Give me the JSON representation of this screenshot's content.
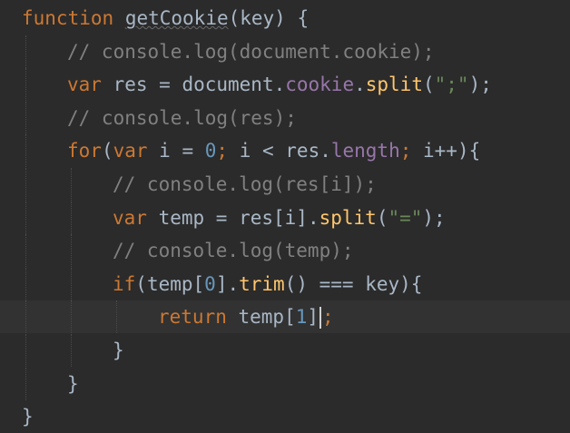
{
  "editor": {
    "lines": [
      {
        "tokens": [
          {
            "t": "kw",
            "v": "function"
          },
          {
            "t": "op",
            "v": " "
          },
          {
            "t": "fn-def",
            "v": "getCookie"
          },
          {
            "t": "op",
            "v": "(key) {"
          }
        ],
        "indent": 0
      },
      {
        "tokens": [
          {
            "t": "cm",
            "v": "// console.log(document.cookie);"
          }
        ],
        "indent": 1
      },
      {
        "tokens": [
          {
            "t": "kw",
            "v": "var"
          },
          {
            "t": "op",
            "v": " res = document."
          },
          {
            "t": "prop",
            "v": "cookie"
          },
          {
            "t": "op",
            "v": "."
          },
          {
            "t": "fn",
            "v": "split"
          },
          {
            "t": "op",
            "v": "("
          },
          {
            "t": "str",
            "v": "\";\""
          },
          {
            "t": "op",
            "v": ");"
          }
        ],
        "indent": 1
      },
      {
        "tokens": [
          {
            "t": "cm",
            "v": "// console.log(res);"
          }
        ],
        "indent": 1
      },
      {
        "tokens": [
          {
            "t": "kw",
            "v": "for"
          },
          {
            "t": "op",
            "v": "("
          },
          {
            "t": "kw",
            "v": "var"
          },
          {
            "t": "op",
            "v": " i = "
          },
          {
            "t": "num",
            "v": "0"
          },
          {
            "t": "kw",
            "v": ";"
          },
          {
            "t": "op",
            "v": " i < res."
          },
          {
            "t": "prop",
            "v": "length"
          },
          {
            "t": "kw",
            "v": ";"
          },
          {
            "t": "op",
            "v": " i++){"
          }
        ],
        "indent": 1
      },
      {
        "tokens": [
          {
            "t": "cm",
            "v": "// console.log(res[i]);"
          }
        ],
        "indent": 2
      },
      {
        "tokens": [
          {
            "t": "kw",
            "v": "var"
          },
          {
            "t": "op",
            "v": " temp = res[i]."
          },
          {
            "t": "fn",
            "v": "split"
          },
          {
            "t": "op",
            "v": "("
          },
          {
            "t": "str",
            "v": "\"=\""
          },
          {
            "t": "op",
            "v": ");"
          }
        ],
        "indent": 2
      },
      {
        "tokens": [
          {
            "t": "cm",
            "v": "// console.log(temp);"
          }
        ],
        "indent": 2
      },
      {
        "tokens": [
          {
            "t": "kw",
            "v": "if"
          },
          {
            "t": "op",
            "v": "(temp["
          },
          {
            "t": "num",
            "v": "0"
          },
          {
            "t": "op",
            "v": "]."
          },
          {
            "t": "fn",
            "v": "trim"
          },
          {
            "t": "op",
            "v": "() === key){"
          }
        ],
        "indent": 2
      },
      {
        "tokens": [
          {
            "t": "kw",
            "v": "return"
          },
          {
            "t": "op",
            "v": " temp["
          },
          {
            "t": "num",
            "v": "1"
          },
          {
            "t": "op",
            "v": "]"
          },
          {
            "t": "caret",
            "v": ""
          },
          {
            "t": "kw",
            "v": ";"
          }
        ],
        "indent": 3,
        "current": true
      },
      {
        "tokens": [
          {
            "t": "op",
            "v": "}"
          }
        ],
        "indent": 2
      },
      {
        "tokens": [
          {
            "t": "op",
            "v": "}"
          }
        ],
        "indent": 1
      },
      {
        "tokens": [
          {
            "t": "op",
            "v": "}"
          }
        ],
        "indent": 0
      }
    ]
  }
}
